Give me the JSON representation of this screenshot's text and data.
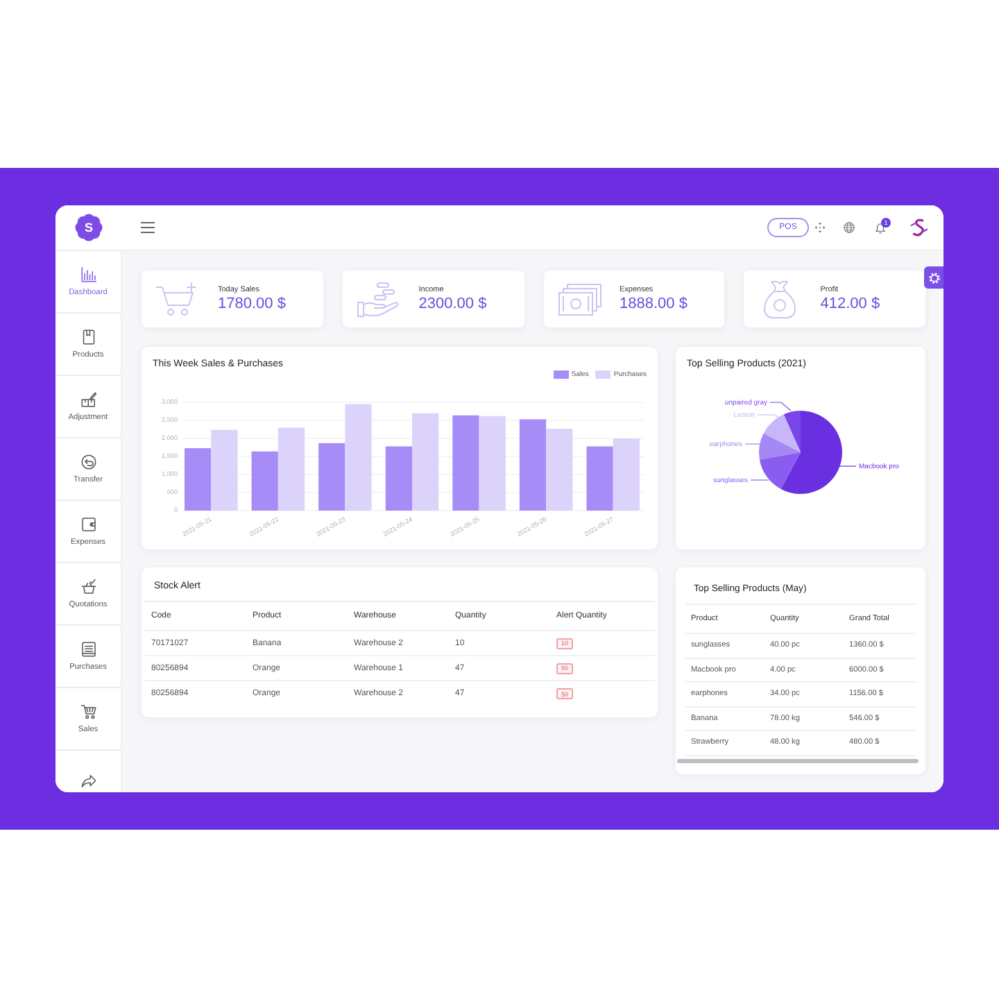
{
  "header": {
    "logo": "S",
    "pos_button": "POS",
    "notification_count": "1"
  },
  "sidebar": {
    "items": [
      {
        "label": "Dashboard",
        "selected": true
      },
      {
        "label": "Products",
        "selected": false
      },
      {
        "label": "Adjustment",
        "selected": false
      },
      {
        "label": "Transfer",
        "selected": false
      },
      {
        "label": "Expenses",
        "selected": false
      },
      {
        "label": "Quotations",
        "selected": false
      },
      {
        "label": "Purchases",
        "selected": false
      },
      {
        "label": "Sales",
        "selected": false
      },
      {
        "selected": false
      }
    ]
  },
  "stats": [
    {
      "label": "Today Sales",
      "value": "1780.00 $"
    },
    {
      "label": "Income",
      "value": "2300.00 $"
    },
    {
      "label": "Expenses",
      "value": "1888.00 $"
    },
    {
      "label": "Profit",
      "value": "412.00 $"
    }
  ],
  "sales_chart": {
    "chart_data": {
      "type": "bar",
      "title": "This Week Sales & Purchases",
      "categories": [
        "2021-05-21",
        "2021-05-22",
        "2021-05-23",
        "2021-05-24",
        "2021-05-25",
        "2021-05-26",
        "2021-05-27"
      ],
      "series": [
        {
          "name": "Sales",
          "color": "#a68cf6",
          "values": [
            1730,
            1640,
            1870,
            1780,
            2640,
            2530,
            1780
          ]
        },
        {
          "name": "Purchases",
          "color": "#dcd3fb",
          "values": [
            2240,
            2300,
            2950,
            2700,
            2620,
            2270,
            2000
          ]
        }
      ],
      "ylim": [
        0,
        3000
      ],
      "yticks": [
        0,
        500,
        {
          "value": 1000,
          "label": "1,000"
        },
        {
          "value": 1500,
          "label": "1,500"
        },
        {
          "value": 2000,
          "label": "2,000"
        },
        {
          "value": 2500,
          "label": "2,500"
        },
        {
          "value": 3000,
          "label": "3,000"
        }
      ],
      "grid": true
    }
  },
  "top_products_year": {
    "title": "Top Selling Products (2021)",
    "slices": [
      {
        "label": "unpaired gray",
        "color": "#7b46e8"
      },
      {
        "label": "Lemon",
        "color": "#c7b6f8"
      },
      {
        "label": "earphones",
        "color": "#a488f3"
      },
      {
        "label": "sunglasses",
        "color": "#8a5df0"
      },
      {
        "label": "Macbook pro",
        "color": "#6a2fe0"
      }
    ]
  },
  "stock_alert": {
    "title": "Stock Alert",
    "columns": [
      "Code",
      "Product",
      "Warehouse",
      "Quantity",
      "Alert Quantity"
    ],
    "rows": [
      {
        "code": "70171027",
        "product": "Banana",
        "warehouse": "Warehouse 2",
        "quantity": "10",
        "alert_quantity": "10"
      },
      {
        "code": "80256894",
        "product": "Orange",
        "warehouse": "Warehouse 1",
        "quantity": "47",
        "alert_quantity": "50"
      },
      {
        "code": "80256894",
        "product": "Orange",
        "warehouse": "Warehouse 2",
        "quantity": "47",
        "alert_quantity": "50"
      }
    ]
  },
  "top_products_month": {
    "title": "Top Selling Products (May)",
    "columns": [
      "Product",
      "Quantity",
      "Grand Total"
    ],
    "rows": [
      {
        "product": "sunglasses",
        "quantity": "40.00 pc",
        "grand_total": "1360.00 $"
      },
      {
        "product": "Macbook pro",
        "quantity": "4.00 pc",
        "grand_total": "6000.00 $"
      },
      {
        "product": "earphones",
        "quantity": "34.00 pc",
        "grand_total": "1156.00 $"
      },
      {
        "product": "Banana",
        "quantity": "78.00 kg",
        "grand_total": "546.00 $"
      },
      {
        "product": "Strawberry",
        "quantity": "48.00 kg",
        "grand_total": "480.00 $"
      }
    ]
  }
}
